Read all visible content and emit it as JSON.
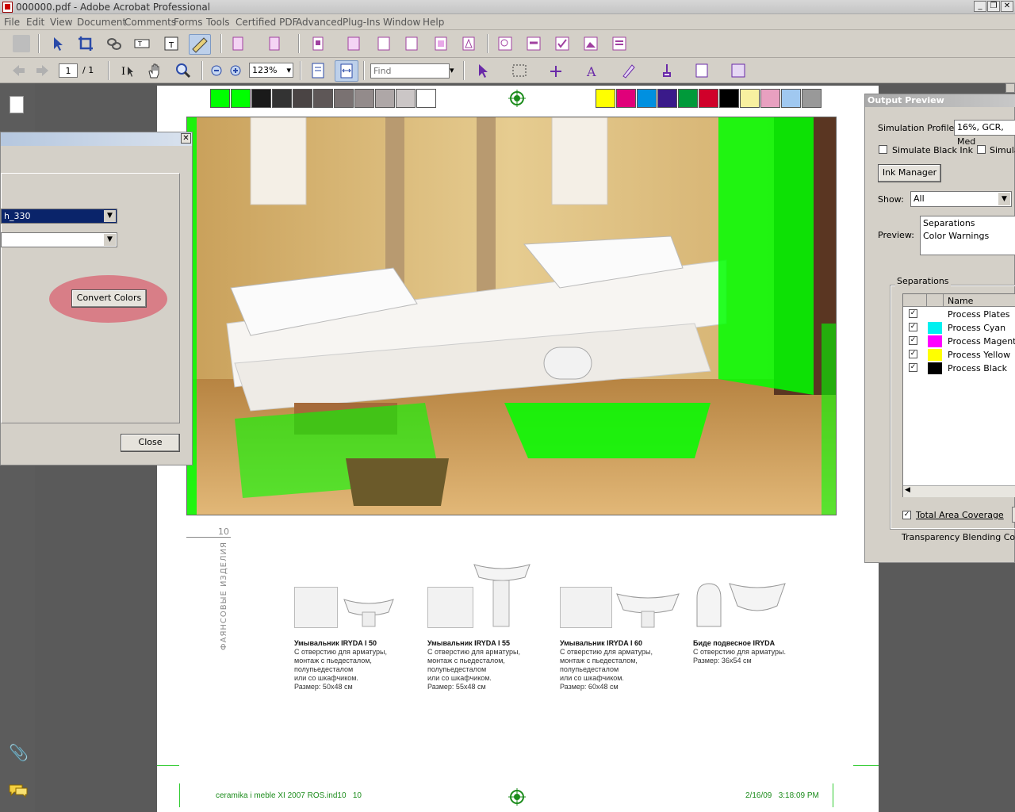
{
  "window": {
    "title": "000000.pdf - Adobe Acrobat Professional"
  },
  "menu": [
    "File",
    "Edit",
    "View",
    "Document",
    "Comments",
    "Forms",
    "Tools",
    "Certified PDF",
    "Advanced",
    "Plug-Ins",
    "Window",
    "Help"
  ],
  "nav": {
    "page_value": "1",
    "page_total": "/ 1",
    "zoom": "123%",
    "find_placeholder": "Find"
  },
  "convert_dialog": {
    "profile_value": "h_330",
    "second_value": "",
    "convert_label": "Convert Colors",
    "close_label": "Close"
  },
  "output_preview": {
    "title": "Output Preview",
    "sim_profile_label": "Simulation Profile:",
    "sim_profile_value": "16%, GCR, Med",
    "sim_black_label": "Simulate Black Ink",
    "sim_paper_label": "Simulat",
    "ink_manager_label": "Ink Manager",
    "show_label": "Show:",
    "show_value": "All",
    "preview_label": "Preview:",
    "preview_options": [
      "Separations",
      "Color Warnings"
    ],
    "separations_group": "Separations",
    "col_name": "Name",
    "plates": [
      {
        "name": "Process Plates",
        "color": ""
      },
      {
        "name": "Process Cyan",
        "color": "#00f0f0"
      },
      {
        "name": "Process Magenta",
        "color": "#ff00ff"
      },
      {
        "name": "Process Yellow",
        "color": "#ffff00"
      },
      {
        "name": "Process Black",
        "color": "#000000"
      }
    ],
    "total_area_label": "Total Area Coverage",
    "transparency_label": "Transparency Blending Color S"
  },
  "page": {
    "page_number": "10",
    "vertical_label": "ФАЯНСОВЫЕ ИЗДЕЛИЯ",
    "footer_left": "ceramika i meble XI 2007 ROS.ind10   10",
    "footer_right": "2/16/09   3:18:09 PM",
    "products": [
      {
        "title": "Умывальник IRYDA I 50",
        "lines": [
          "С отверстию для арматуры,",
          "монтаж с пьедесталом,",
          "полупьедесталом",
          "или со шкафчиком.",
          "Размер: 50x48 см"
        ]
      },
      {
        "title": "Умывальник IRYDA I 55",
        "lines": [
          "С отверстию для арматуры,",
          "монтаж с пьедесталом,",
          "полупьедесталом",
          "или со шкафчиком.",
          "Размер: 55x48 см"
        ]
      },
      {
        "title": "Умывальник IRYDA I 60",
        "lines": [
          "С отверстию для арматуры,",
          "монтаж с пьедесталом,",
          "полупьедесталом",
          "или со шкафчиком.",
          "Размер: 60x48 см"
        ]
      },
      {
        "title": "Биде подвесное IRYDA",
        "lines": [
          "С отверстию для арматуры.",
          "Размер: 36x54 см"
        ]
      }
    ]
  },
  "colors": {
    "warning_green": "#00ff00",
    "grey_bar": [
      "#00ff00",
      "#00ff00",
      "#1a1a1a",
      "#333",
      "#4a4444",
      "#5e5757",
      "#7a7272",
      "#938b8b",
      "#aea7a7",
      "#cbc6c6",
      "#fff"
    ],
    "color_bar": [
      "#ffff00",
      "#e0007a",
      "#0090e0",
      "#3a1a8a",
      "#009a3a",
      "#d0002a",
      "#000",
      "#f8f0a0",
      "#e8a0c0",
      "#a0c8f0",
      "#999"
    ]
  }
}
